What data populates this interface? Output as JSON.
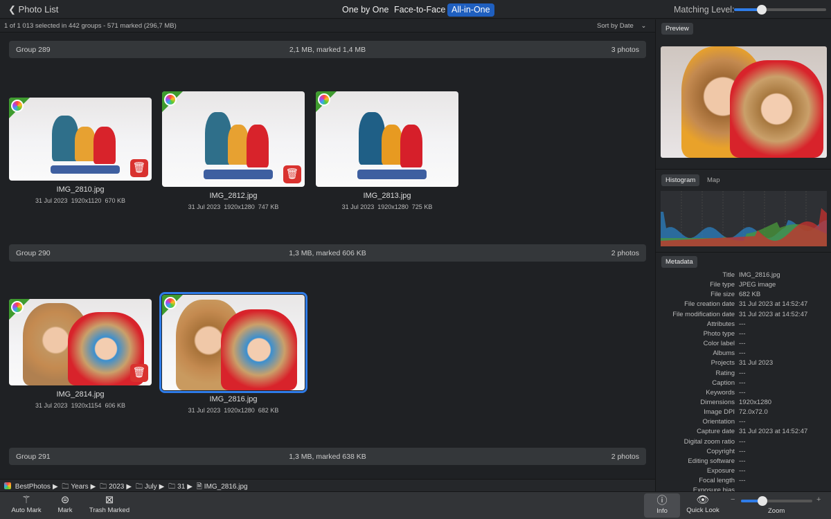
{
  "topbar": {
    "back_label": "Photo List",
    "modes": [
      "One by One",
      "Face-to-Face",
      "All-in-One"
    ],
    "active_mode": "All-in-One",
    "matching_label": "Matching Level:",
    "matching_level": 0.3
  },
  "status": {
    "text": "1 of 1 013 selected in 442 groups - 571 marked (296,7 MB)",
    "sort": "Sort by Date"
  },
  "groups": [
    {
      "name": "Group 289",
      "size": "2,1 MB, marked 1,4 MB",
      "count": "3 photos",
      "photos": [
        {
          "name": "IMG_2810.jpg",
          "date": "31 Jul 2023",
          "dims": "1920x1120",
          "size": "670 KB",
          "marked": true
        },
        {
          "name": "IMG_2812.jpg",
          "date": "31 Jul 2023",
          "dims": "1920x1280",
          "size": "747 KB",
          "marked": true
        },
        {
          "name": "IMG_2813.jpg",
          "date": "31 Jul 2023",
          "dims": "1920x1280",
          "size": "725 KB",
          "marked": false
        }
      ]
    },
    {
      "name": "Group 290",
      "size": "1,3 MB, marked 606 KB",
      "count": "2 photos",
      "photos": [
        {
          "name": "IMG_2814.jpg",
          "date": "31 Jul 2023",
          "dims": "1920x1154",
          "size": "606 KB",
          "marked": true
        },
        {
          "name": "IMG_2816.jpg",
          "date": "31 Jul 2023",
          "dims": "1920x1280",
          "size": "682 KB",
          "marked": false,
          "selected": true
        }
      ]
    },
    {
      "name": "Group 291",
      "size": "1,3 MB, marked 638 KB",
      "count": "2 photos"
    }
  ],
  "breadcrumb": [
    "BestPhotos",
    "Years",
    "2023",
    "July",
    "31",
    "IMG_2816.jpg"
  ],
  "toolbar": {
    "auto_mark": "Auto Mark",
    "mark": "Mark",
    "trash_marked": "Trash Marked",
    "info": "Info",
    "quick_look": "Quick Look",
    "zoom": "Zoom",
    "zoom_minus": "−",
    "zoom_plus": "+",
    "zoom_level": 0.3
  },
  "right": {
    "preview_tab": "Preview",
    "histogram_tab": "Histogram",
    "map_tab": "Map",
    "metadata_tab": "Metadata",
    "metadata": [
      [
        "Title",
        "IMG_2816.jpg"
      ],
      [
        "File type",
        "JPEG image"
      ],
      [
        "File size",
        "682 KB"
      ],
      [
        "File creation date",
        "31 Jul 2023 at 14:52:47"
      ],
      [
        "File modification date",
        "31 Jul 2023 at 14:52:47"
      ],
      [
        "Attributes",
        "---"
      ],
      [
        "Photo type",
        "---"
      ],
      [
        "Color label",
        "---"
      ],
      [
        "Albums",
        "---"
      ],
      [
        "Projects",
        "31 Jul 2023"
      ],
      [
        "Rating",
        "---"
      ],
      [
        "Caption",
        "---"
      ],
      [
        "Keywords",
        "---"
      ],
      [
        "Dimensions",
        "1920x1280"
      ],
      [
        "Image DPI",
        "72.0x72.0"
      ],
      [
        "Orientation",
        "---"
      ],
      [
        "Capture date",
        "31 Jul 2023 at 14:52:47"
      ],
      [
        "Digital zoom ratio",
        "---"
      ],
      [
        "Copyright",
        "---"
      ],
      [
        "Editing software",
        "---"
      ],
      [
        "Exposure",
        "---"
      ],
      [
        "Focal length",
        "---"
      ],
      [
        "Exposure bias",
        ""
      ]
    ]
  },
  "colors": {
    "accent": "#2f7ce8",
    "trash": "#d9322f",
    "mark_badge": "#3f9b2f"
  }
}
